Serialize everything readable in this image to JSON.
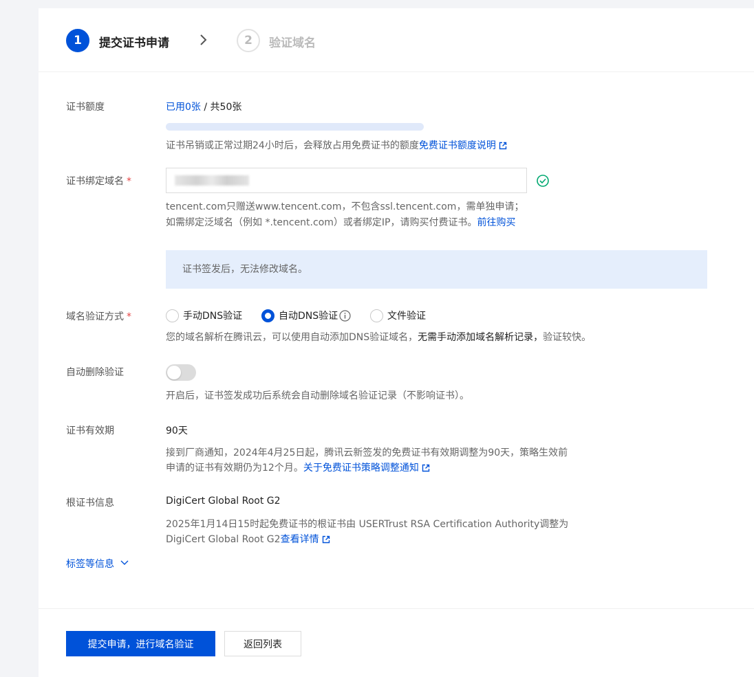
{
  "steps": [
    {
      "number": "1",
      "label": "提交证书申请"
    },
    {
      "number": "2",
      "label": "验证域名"
    }
  ],
  "quota": {
    "label": "证书额度",
    "used": "已用0张",
    "separator": " / ",
    "total": "共50张",
    "used_fraction": 0,
    "hint": "证书吊销或正常过期24小时后，会释放占用免费证书的额度",
    "hint_link": "免费证书额度说明"
  },
  "domain": {
    "label": "证书绑定域名",
    "required_mark": "*",
    "hint_line1": "tencent.com只赠送www.tencent.com，不包含ssl.tencent.com，需单独申请；",
    "hint_line2": "如需绑定泛域名（例如 *.tencent.com）或者绑定IP，请购买付费证书。",
    "hint_link": "前往购买",
    "notice": "证书签发后，无法修改域名。"
  },
  "verify": {
    "label": "域名验证方式",
    "required_mark": "*",
    "options": [
      "手动DNS验证",
      "自动DNS验证",
      "文件验证"
    ],
    "selected": "自动DNS验证",
    "hint_prefix": "您的域名解析在腾讯云，可以使用自动添加DNS验证域名，",
    "hint_bold": "无需手动添加域名解析记录，",
    "hint_suffix": "验证较快。"
  },
  "auto_delete": {
    "label": "自动删除验证",
    "enabled": false,
    "hint": "开启后，证书签发成功后系统会自动删除域名验证记录（不影响证书）。"
  },
  "validity": {
    "label": "证书有效期",
    "value": "90天",
    "hint_line1": "接到厂商通知，2024年4月25日起，腾讯云新签发的免费证书有效期调整为90天，策略生效前",
    "hint_line2": "申请的证书有效期仍为12个月。",
    "hint_link": "关于免费证书策略调整通知"
  },
  "root_cert": {
    "label": "根证书信息",
    "value": "DigiCert Global Root G2",
    "hint_line1": "2025年1月14日15时起免费证书的根证书由 USERTrust RSA Certification Authority调整为",
    "hint_line2": "DigiCert Global Root G2",
    "hint_link": "查看详情"
  },
  "more_link": "标签等信息",
  "buttons": {
    "submit": "提交申请，进行域名验证",
    "back": "返回列表"
  },
  "colors": {
    "primary": "#0052d9",
    "success": "#00a870",
    "required": "#e54545",
    "notice_bg": "#e5eefc"
  }
}
